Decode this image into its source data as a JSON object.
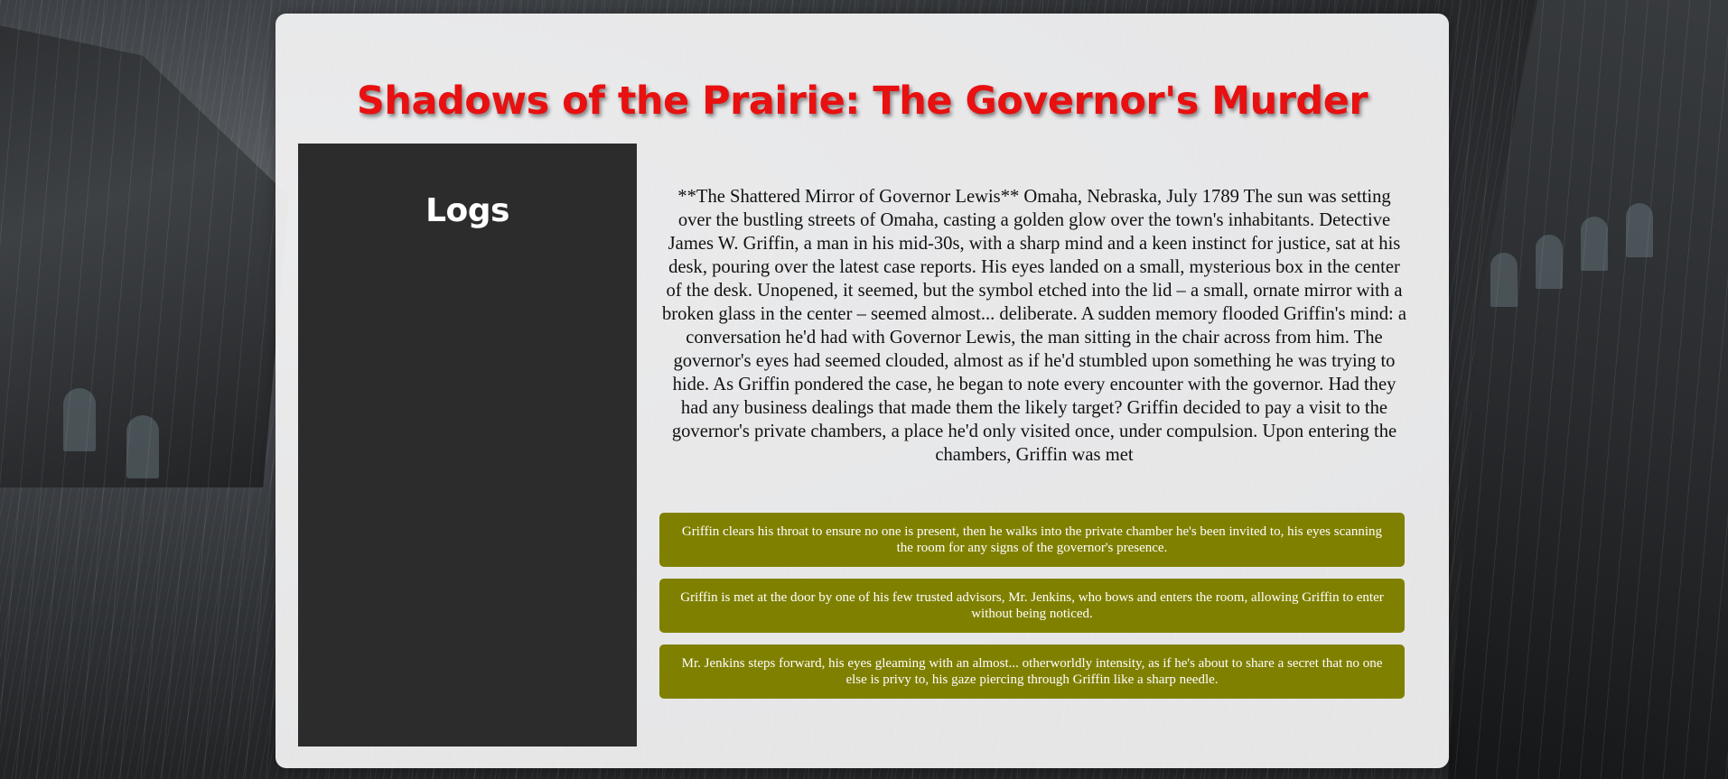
{
  "game": {
    "title": "Shadows of the Prairie: The Governor's Murder"
  },
  "logs": {
    "heading": "Logs",
    "entries": []
  },
  "story": {
    "text": "**The Shattered Mirror of Governor Lewis** Omaha, Nebraska, July 1789 The sun was setting over the bustling streets of Omaha, casting a golden glow over the town's inhabitants. Detective James W. Griffin, a man in his mid-30s, with a sharp mind and a keen instinct for justice, sat at his desk, pouring over the latest case reports. His eyes landed on a small, mysterious box in the center of the desk. Unopened, it seemed, but the symbol etched into the lid – a small, ornate mirror with a broken glass in the center – seemed almost... deliberate. A sudden memory flooded Griffin's mind: a conversation he'd had with Governor Lewis, the man sitting in the chair across from him. The governor's eyes had seemed clouded, almost as if he'd stumbled upon something he was trying to hide. As Griffin pondered the case, he began to note every encounter with the governor. Had they had any business dealings that made them the likely target? Griffin decided to pay a visit to the governor's private chambers, a place he'd only visited once, under compulsion. Upon entering the chambers, Griffin was met"
  },
  "choices": [
    {
      "label": "Griffin clears his throat to ensure no one is present, then he walks into the private chamber he's been invited to, his eyes scanning the room for any signs of the governor's presence."
    },
    {
      "label": "Griffin is met at the door by one of his few trusted advisors, Mr. Jenkins, who bows and enters the room, allowing Griffin to enter without being noticed."
    },
    {
      "label": "Mr. Jenkins steps forward, his eyes gleaming with an almost... otherworldly intensity, as if he's about to share a secret that no one else is privy to, his gaze piercing through Griffin like a sharp needle."
    }
  ],
  "colors": {
    "title": "#e81010",
    "choice_button": "#808000",
    "logs_panel": "#2c2c2c"
  }
}
